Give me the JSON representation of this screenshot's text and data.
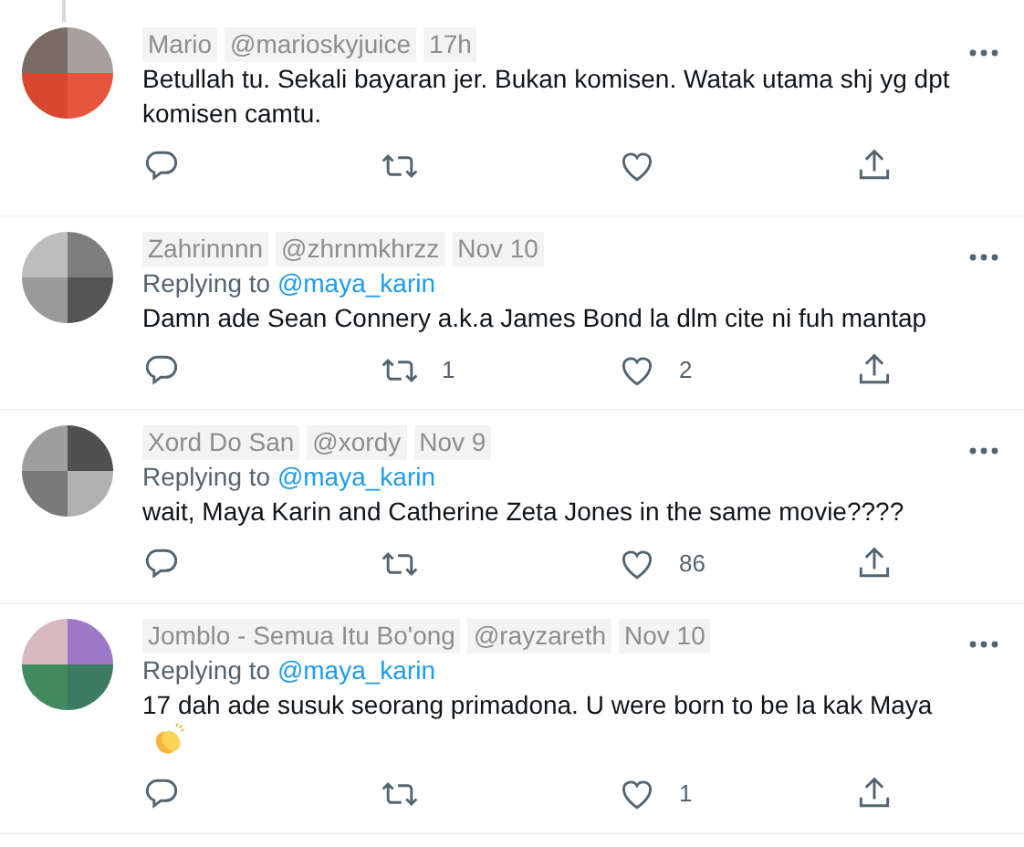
{
  "tweets": [
    {
      "author": "Mario",
      "handle": "@marioskyjuice",
      "time": "17h",
      "connected_above": true,
      "text": "Betullah tu. Sekali bayaran jer. Bukan komisen. Watak utama shj yg dpt komisen camtu.",
      "emoji": false
    },
    {
      "author": "Zahrinnnn",
      "handle": "@zhrnmkhrzz",
      "time": "Nov 10",
      "connected_above": false,
      "replying_label": "Replying to",
      "replying_to": "@maya_karin",
      "text": "Damn ade Sean Connery a.k.a James Bond la dlm cite ni fuh mantap",
      "retweets": "1",
      "likes": "2",
      "emoji": false
    },
    {
      "author": "Xord Do San",
      "handle": "@xordy",
      "time": "Nov 9",
      "connected_above": false,
      "replying_label": "Replying to",
      "replying_to": "@maya_karin",
      "text": "wait, Maya Karin and Catherine Zeta Jones in the same movie????",
      "likes": "86",
      "emoji": false
    },
    {
      "author": "Jomblo - Semua Itu Bo'ong",
      "handle": "@rayzareth",
      "time": "Nov 10",
      "connected_above": false,
      "replying_label": "Replying to",
      "replying_to": "@maya_karin",
      "text": "17 dah ade susuk seorang primadona. U were born to be la kak Maya",
      "likes": "1",
      "emoji": true
    }
  ]
}
